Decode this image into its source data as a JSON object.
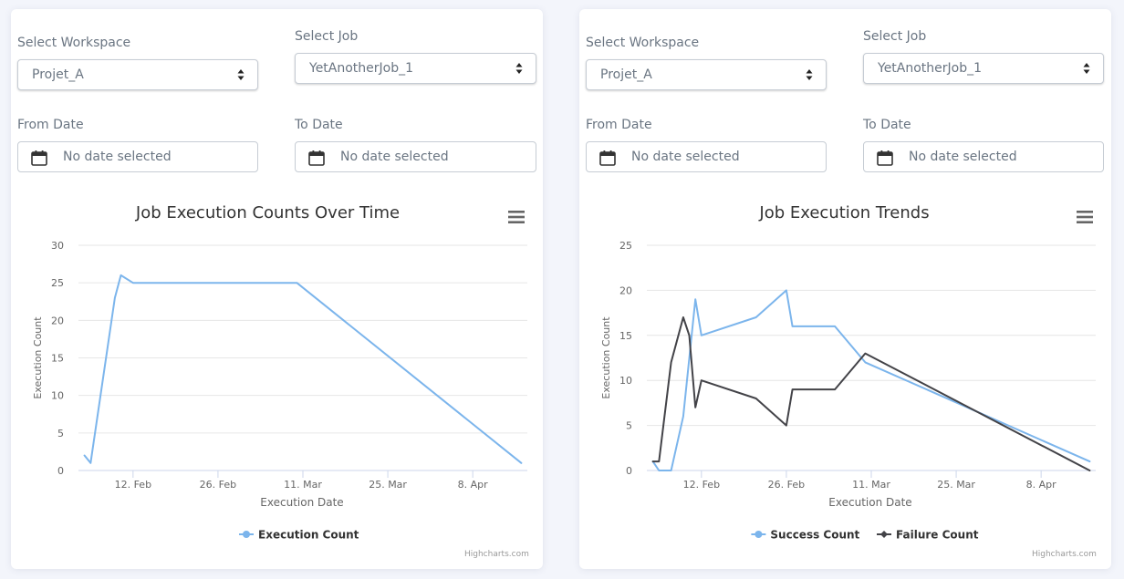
{
  "panels": [
    {
      "filters": {
        "workspace_label": "Select Workspace",
        "workspace_value": "Projet_A",
        "job_label": "Select Job",
        "job_value": "YetAnotherJob_1",
        "from_label": "From Date",
        "from_placeholder": "No date selected",
        "to_label": "To Date",
        "to_placeholder": "No date selected"
      },
      "credits": "Highcharts.com"
    },
    {
      "filters": {
        "workspace_label": "Select Workspace",
        "workspace_value": "Projet_A",
        "job_label": "Select Job",
        "job_value": "YetAnotherJob_1",
        "from_label": "From Date",
        "from_placeholder": "No date selected",
        "to_label": "To Date",
        "to_placeholder": "No date selected"
      },
      "credits": "Highcharts.com"
    }
  ],
  "colors": {
    "series_blue": "#7cb5ec",
    "series_black": "#434348",
    "grid": "#e6e6e6",
    "axis_text": "#666666"
  },
  "chart_data": [
    {
      "type": "line",
      "title": "Job Execution Counts Over Time",
      "xlabel": "Execution Date",
      "ylabel": "Execution Count",
      "x_ticks": [
        "12. Feb",
        "26. Feb",
        "11. Mar",
        "25. Mar",
        "8. Apr"
      ],
      "y_ticks": [
        0,
        5,
        10,
        15,
        20,
        25,
        30
      ],
      "ylim": [
        0,
        30
      ],
      "grid": true,
      "legend": "bottom-center",
      "series": [
        {
          "name": "Execution Count",
          "color": "#7cb5ec",
          "marker": "circle",
          "points": [
            [
              "2025-02-01",
              2
            ],
            [
              "2025-02-02",
              1
            ],
            [
              "2025-02-06",
              23
            ],
            [
              "2025-02-07",
              26
            ],
            [
              "2025-02-09",
              25
            ],
            [
              "2025-03-08",
              25
            ],
            [
              "2025-04-14",
              1
            ]
          ]
        }
      ]
    },
    {
      "type": "line",
      "title": "Job Execution Trends",
      "xlabel": "Execution Date",
      "ylabel": "Execution Count",
      "x_ticks": [
        "12. Feb",
        "26. Feb",
        "11. Mar",
        "25. Mar",
        "8. Apr"
      ],
      "y_ticks": [
        0,
        5,
        10,
        15,
        20,
        25
      ],
      "ylim": [
        0,
        25
      ],
      "grid": true,
      "legend": "bottom-center",
      "series": [
        {
          "name": "Success Count",
          "color": "#7cb5ec",
          "marker": "circle",
          "points": [
            [
              "2025-02-01",
              1
            ],
            [
              "2025-02-02",
              0
            ],
            [
              "2025-02-04",
              0
            ],
            [
              "2025-02-06",
              6
            ],
            [
              "2025-02-08",
              19
            ],
            [
              "2025-02-09",
              15
            ],
            [
              "2025-02-18",
              17
            ],
            [
              "2025-02-23",
              20
            ],
            [
              "2025-02-24",
              16
            ],
            [
              "2025-03-03",
              16
            ],
            [
              "2025-03-08",
              12
            ],
            [
              "2025-04-14",
              1
            ]
          ]
        },
        {
          "name": "Failure Count",
          "color": "#434348",
          "marker": "diamond",
          "points": [
            [
              "2025-02-01",
              1
            ],
            [
              "2025-02-02",
              1
            ],
            [
              "2025-02-04",
              12
            ],
            [
              "2025-02-06",
              17
            ],
            [
              "2025-02-07",
              15
            ],
            [
              "2025-02-08",
              7
            ],
            [
              "2025-02-09",
              10
            ],
            [
              "2025-02-18",
              8
            ],
            [
              "2025-02-23",
              5
            ],
            [
              "2025-02-24",
              9
            ],
            [
              "2025-03-03",
              9
            ],
            [
              "2025-03-08",
              13
            ],
            [
              "2025-04-14",
              0
            ]
          ]
        }
      ]
    }
  ]
}
